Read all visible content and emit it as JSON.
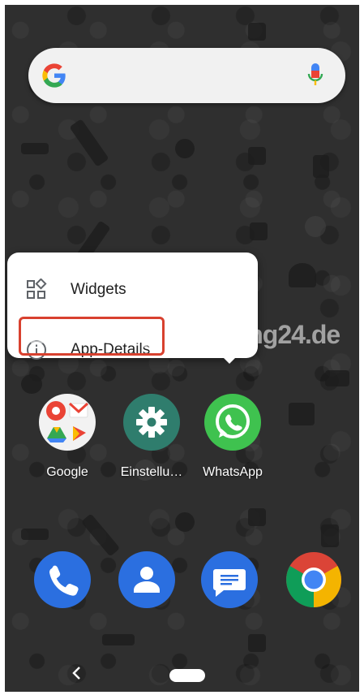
{
  "search": {
    "logo_icon": "google-g-icon",
    "mic_icon": "microphone-icon"
  },
  "popup": {
    "items": [
      {
        "label": "Widgets",
        "icon": "widgets-icon"
      },
      {
        "label": "App-Details",
        "icon": "info-icon"
      }
    ],
    "highlight_color": "#d8412f"
  },
  "watermark": {
    "text": "Bedienungsanleitung24.de"
  },
  "apps": [
    {
      "label": "Google",
      "icon": "google-folder-icon"
    },
    {
      "label": "Einstellu…",
      "icon": "settings-gear-icon",
      "color": "#2f7d6d"
    },
    {
      "label": "WhatsApp",
      "icon": "whatsapp-icon",
      "color": "#3fc24f"
    }
  ],
  "dock": [
    {
      "icon": "phone-icon"
    },
    {
      "icon": "contacts-icon"
    },
    {
      "icon": "messages-icon"
    },
    {
      "icon": "chrome-icon"
    }
  ],
  "navbar": {
    "back_icon": "back-chevron-icon",
    "home_icon": "home-pill-icon"
  }
}
